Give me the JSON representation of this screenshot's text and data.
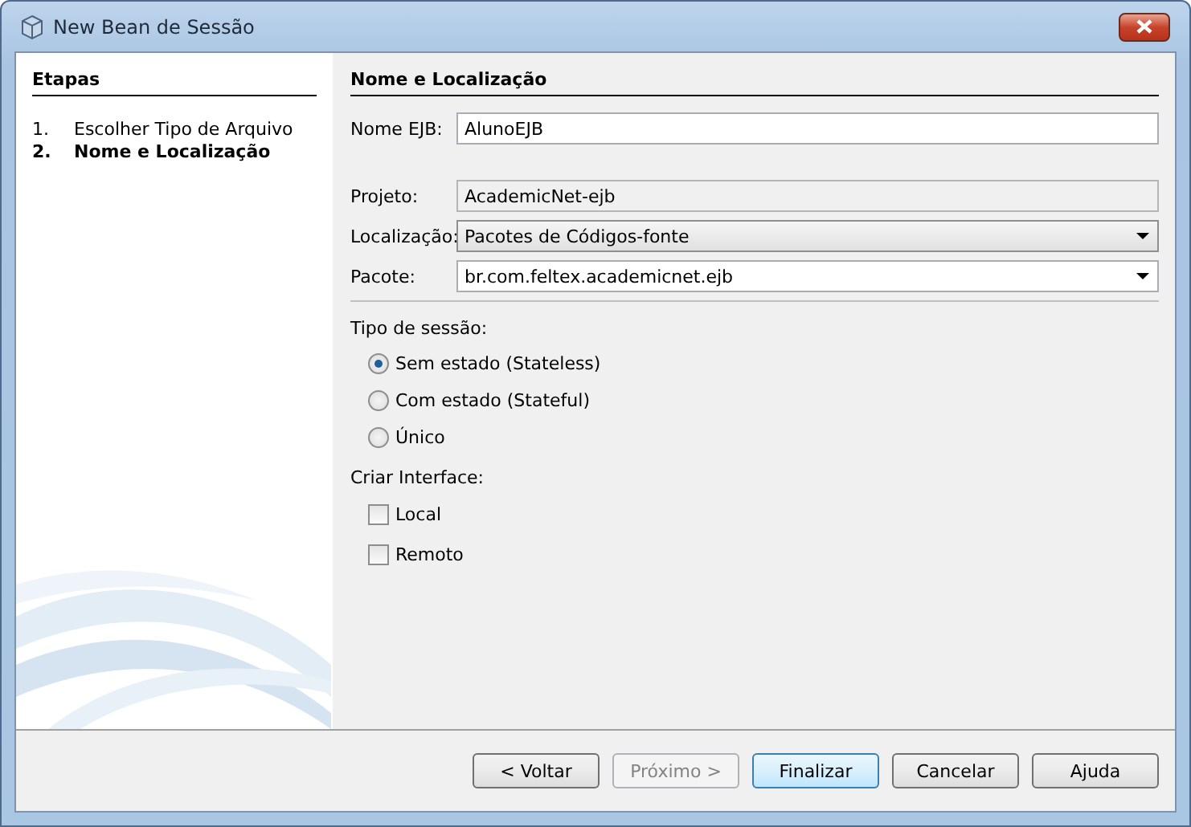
{
  "window": {
    "title": "New Bean de Sessão"
  },
  "steps": {
    "title": "Etapas",
    "items": [
      {
        "number": "1.",
        "label": "Escolher Tipo de Arquivo",
        "selected": false
      },
      {
        "number": "2.",
        "label": "Nome e Localização",
        "selected": true
      }
    ]
  },
  "panel_title": "Nome e Localização",
  "fields": [
    {
      "kind": "text",
      "label": "Nome EJB:",
      "value": "AlunoEJB"
    },
    {
      "kind": "readonly",
      "label": "Projeto:",
      "value": "AcademicNet-ejb"
    },
    {
      "kind": "combo",
      "label": "Localização:",
      "value": "Pacotes de Códigos-fonte"
    },
    {
      "kind": "editable-combo",
      "label": "Pacote:",
      "value": "br.com.feltex.academicnet.ejb"
    }
  ],
  "session_type": {
    "label": "Tipo de sessão:",
    "options": [
      {
        "label": "Sem estado (Stateless)",
        "selected": true
      },
      {
        "label": "Com estado (Stateful)",
        "selected": false
      },
      {
        "label": "Único",
        "selected": false
      }
    ]
  },
  "create_interface": {
    "label": "Criar Interface:",
    "options": [
      {
        "label": "Local",
        "checked": false
      },
      {
        "label": "Remoto",
        "checked": false
      }
    ]
  },
  "buttons": [
    {
      "label": "< Voltar",
      "disabled": false,
      "default": false
    },
    {
      "label": "Próximo >",
      "disabled": true,
      "default": false
    },
    {
      "label": "Finalizar",
      "disabled": false,
      "default": true
    },
    {
      "label": "Cancelar",
      "disabled": false,
      "default": false
    },
    {
      "label": "Ajuda",
      "disabled": false,
      "default": false
    }
  ]
}
